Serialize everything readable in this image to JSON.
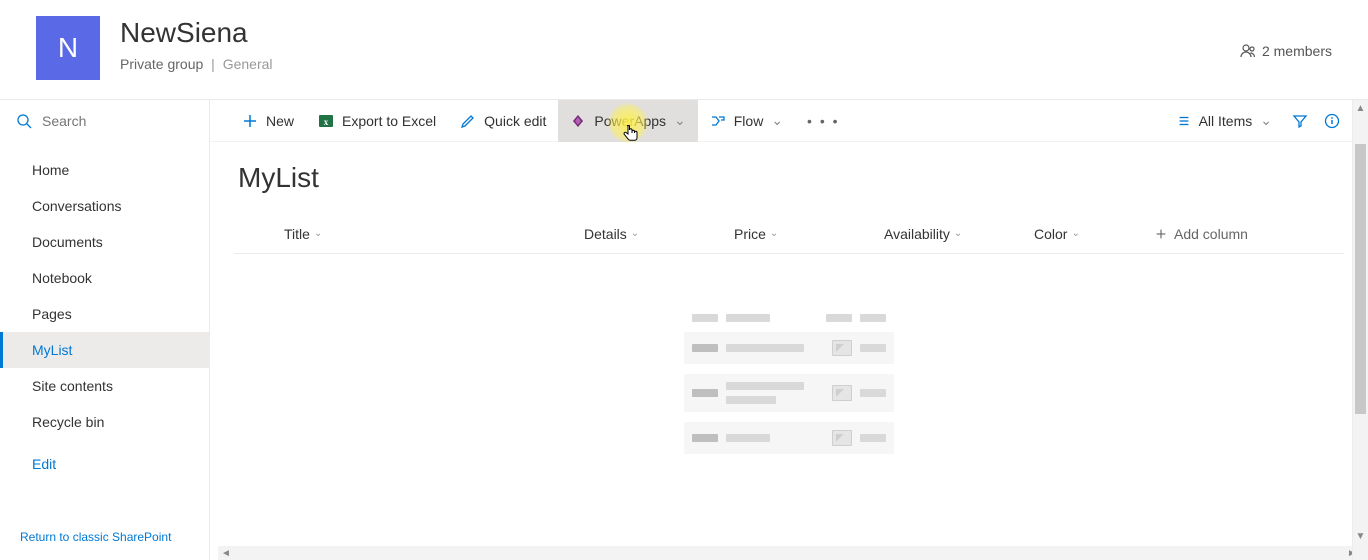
{
  "site": {
    "avatar_letter": "N",
    "title": "NewSiena",
    "privacy": "Private group",
    "visibility": "General",
    "members_label": "2 members"
  },
  "search": {
    "placeholder": "Search"
  },
  "nav": {
    "items": [
      {
        "label": "Home",
        "selected": false
      },
      {
        "label": "Conversations",
        "selected": false
      },
      {
        "label": "Documents",
        "selected": false
      },
      {
        "label": "Notebook",
        "selected": false
      },
      {
        "label": "Pages",
        "selected": false
      },
      {
        "label": "MyList",
        "selected": true
      },
      {
        "label": "Site contents",
        "selected": false
      },
      {
        "label": "Recycle bin",
        "selected": false
      }
    ],
    "edit_label": "Edit",
    "return_label": "Return to classic SharePoint"
  },
  "cmdbar": {
    "new_label": "New",
    "export_label": "Export to Excel",
    "quickedit_label": "Quick edit",
    "powerapps_label": "PowerApps",
    "flow_label": "Flow",
    "allitems_label": "All Items"
  },
  "list": {
    "title": "MyList",
    "columns": {
      "title": "Title",
      "details": "Details",
      "price": "Price",
      "availability": "Availability",
      "color": "Color",
      "add": "Add column"
    }
  }
}
